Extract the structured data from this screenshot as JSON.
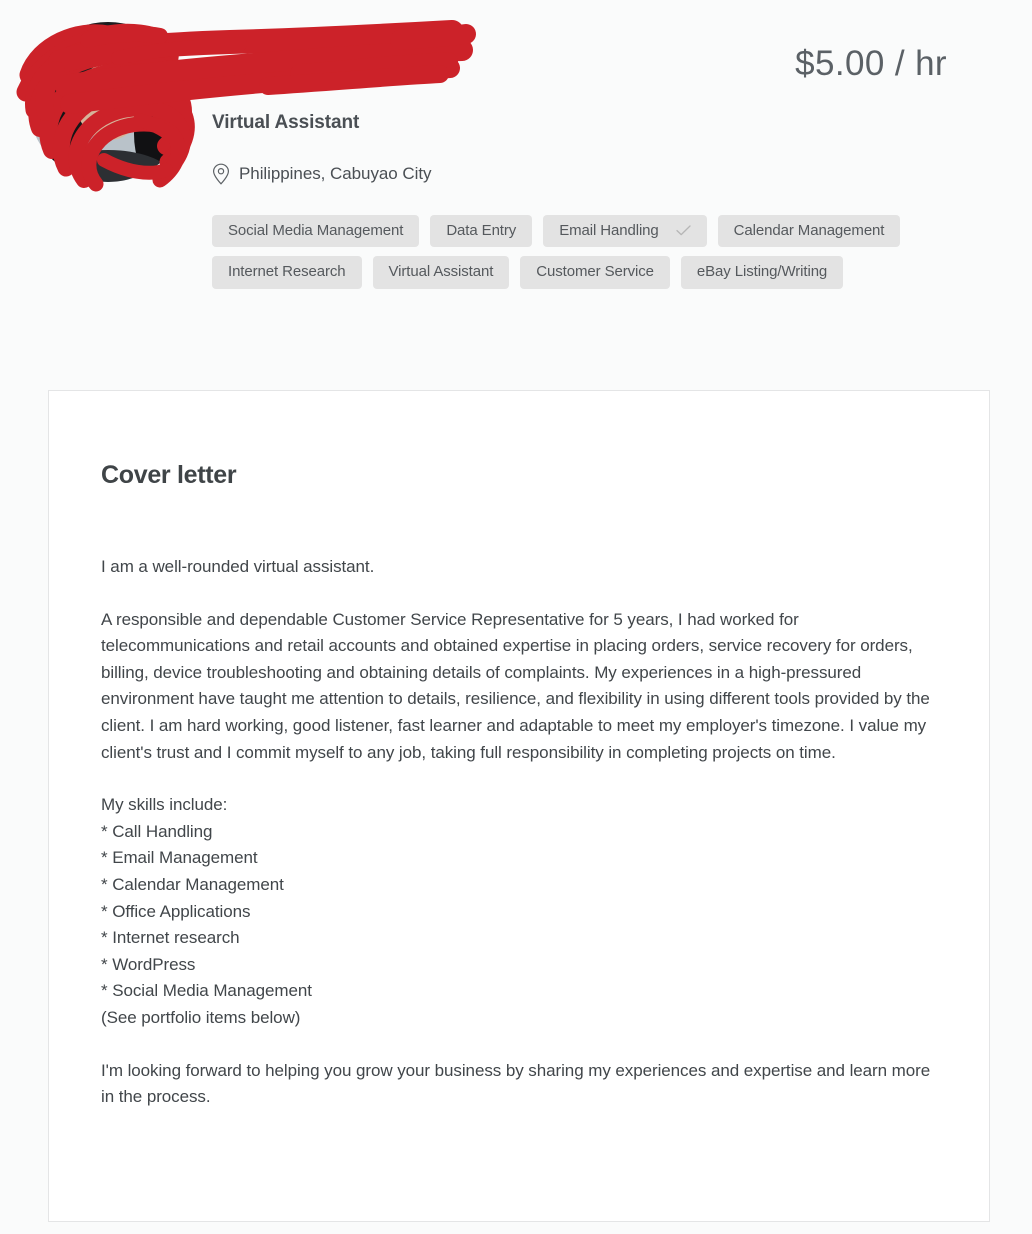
{
  "profile": {
    "name_redacted": true,
    "name_placeholder": "",
    "role": "Virtual Assistant",
    "location": "Philippines, Cabuyao City",
    "rate": "$5.00 / hr",
    "avatar_alt": "profile-photo"
  },
  "skill_tags": [
    {
      "label": "Social Media Management",
      "checked": false
    },
    {
      "label": "Data Entry",
      "checked": false
    },
    {
      "label": "Email Handling",
      "checked": true
    },
    {
      "label": "Calendar Management",
      "checked": false
    },
    {
      "label": "Internet Research",
      "checked": false
    },
    {
      "label": "Virtual Assistant",
      "checked": false
    },
    {
      "label": "Customer Service",
      "checked": false
    },
    {
      "label": "eBay Listing/Writing",
      "checked": false
    }
  ],
  "cover_letter": {
    "heading": "Cover letter",
    "paragraph_1": "I am a well-rounded virtual assistant.",
    "paragraph_2": "A responsible and dependable Customer Service Representative for 5 years, I had worked for telecommunications and retail accounts and obtained expertise in placing orders, service recovery for orders, billing, device troubleshooting and obtaining details of complaints. My experiences in a high-pressured environment have taught me attention to details, resilience, and flexibility in using different tools provided by the client. I am hard working, good listener, fast learner and adaptable to meet my employer's timezone. I value my client's trust and I commit myself to any job, taking full responsibility in completing projects on time.",
    "skills_intro": "My skills include:",
    "skills": [
      "* Call Handling",
      "* Email Management",
      "* Calendar Management",
      "* Office Applications",
      "* Internet research",
      "* WordPress",
      "* Social Media Management"
    ],
    "skills_note": "(See portfolio items below)",
    "paragraph_3": "I'm looking forward to helping you grow your business by sharing my experiences and expertise and learn more in the process."
  },
  "colors": {
    "page_background": "#fafbfb",
    "card_background": "#ffffff",
    "card_border": "#e4e5e6",
    "tag_background": "#e3e3e3",
    "text_primary": "#41464a",
    "text_heading": "#3f4447",
    "redaction_red": "#cc2229"
  },
  "icons": {
    "location_pin": "location-pin-icon",
    "checkmark": "check-icon"
  }
}
